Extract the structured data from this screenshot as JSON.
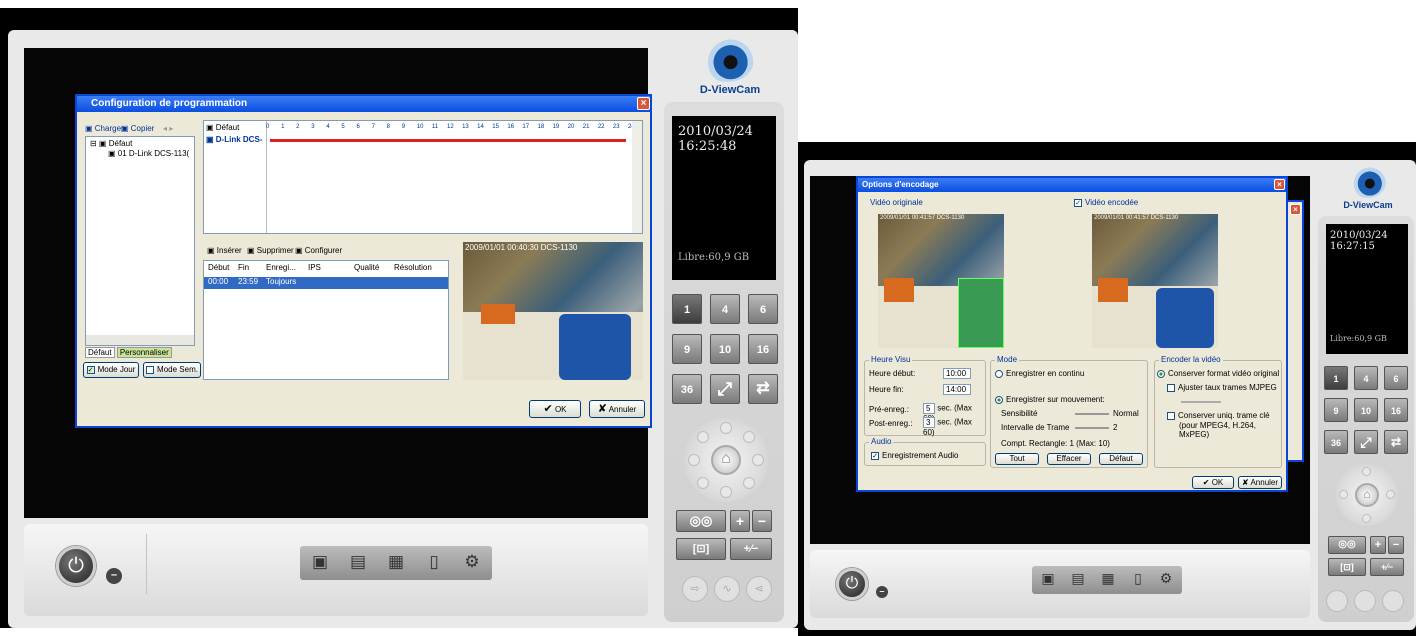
{
  "left": {
    "brand": "D-ViewCam",
    "clock": {
      "date": "2010/03/24",
      "time": "16:25:48",
      "free": "Libre:60,9 GB"
    },
    "layout_buttons": [
      "1",
      "4",
      "6",
      "9",
      "10",
      "16",
      "36"
    ],
    "dialog": {
      "title": "Configuration de programmation",
      "toolbar": {
        "load": "Charger",
        "copy": "Copier"
      },
      "tree": {
        "root": "Défaut",
        "child": "01 D-Link DCS-113("
      },
      "tabs": [
        "Défaut",
        "Personnaliser"
      ],
      "mode_day": "Mode Jour",
      "mode_week": "Mode Sem.",
      "schedule": {
        "header": "Défaut",
        "row": "D-Link DCS-",
        "hours": [
          "0",
          "1",
          "2",
          "3",
          "4",
          "5",
          "6",
          "7",
          "8",
          "9",
          "10",
          "11",
          "12",
          "13",
          "14",
          "15",
          "16",
          "17",
          "18",
          "19",
          "20",
          "21",
          "22",
          "23",
          "24"
        ]
      },
      "actions": {
        "insert": "Insérer",
        "delete": "Supprimer",
        "configure": "Configurer"
      },
      "table": {
        "headers": [
          "Début",
          "Fin",
          "Enregi...",
          "IPS",
          "Qualité",
          "Résolution"
        ],
        "rows": [
          [
            "00:00",
            "23:59",
            "Toujours",
            "",
            "",
            ""
          ]
        ]
      },
      "preview_stamp": "2009/01/01  00:40:30  DCS-1130",
      "ok": "OK",
      "cancel": "Annuler"
    }
  },
  "right": {
    "brand": "D-ViewCam",
    "clock": {
      "date": "2010/03/24",
      "time": "16:27:15",
      "free": "Libre:60,9 GB"
    },
    "layout_buttons": [
      "1",
      "4",
      "6",
      "9",
      "10",
      "16",
      "36"
    ],
    "dialog": {
      "title": "Options d'encodage",
      "original_label": "Vidéo originale",
      "encoded_label": "Vidéo encodée",
      "stamp_left": "2009/01/01  00:41:57  DCS-1130",
      "stamp_right": "2009/01/01  00:41:57  DCS-1130",
      "heure": {
        "legend": "Heure Visu",
        "start_label": "Heure début:",
        "start_value": "10:00",
        "end_label": "Heure fin:",
        "end_value": "14:00",
        "pre_label": "Pré-enreg.:",
        "pre_value": "5",
        "pre_unit": "sec. (Max 60)",
        "post_label": "Post-enreg.:",
        "post_value": "3",
        "post_unit": "sec. (Max 60)"
      },
      "audio": {
        "legend": "Audio",
        "label": "Enregistrement Audio"
      },
      "mode": {
        "legend": "Mode",
        "continuous": "Enregistrer en continu",
        "motion": "Enregistrer sur mouvement:",
        "sensitivity": "Sensibilité",
        "sensitivity_value": "Normal",
        "interval": "Intervalle de Trame",
        "interval_value": "2",
        "count": "Compt. Rectangle: 1  (Max: 10)",
        "buttons": [
          "Tout",
          "Effacer",
          "Défaut"
        ]
      },
      "encode": {
        "legend": "Encoder la vidéo",
        "keep_original": "Conserver format vidéo original",
        "adjust_mjpeg": "Ajuster taux trames MJPEG",
        "keyframe": "Conserver uniq. trame clé",
        "keyframe_note": "(pour MPEG4, H.264, MxPEG)"
      },
      "ok": "OK",
      "cancel": "Annuler"
    }
  }
}
